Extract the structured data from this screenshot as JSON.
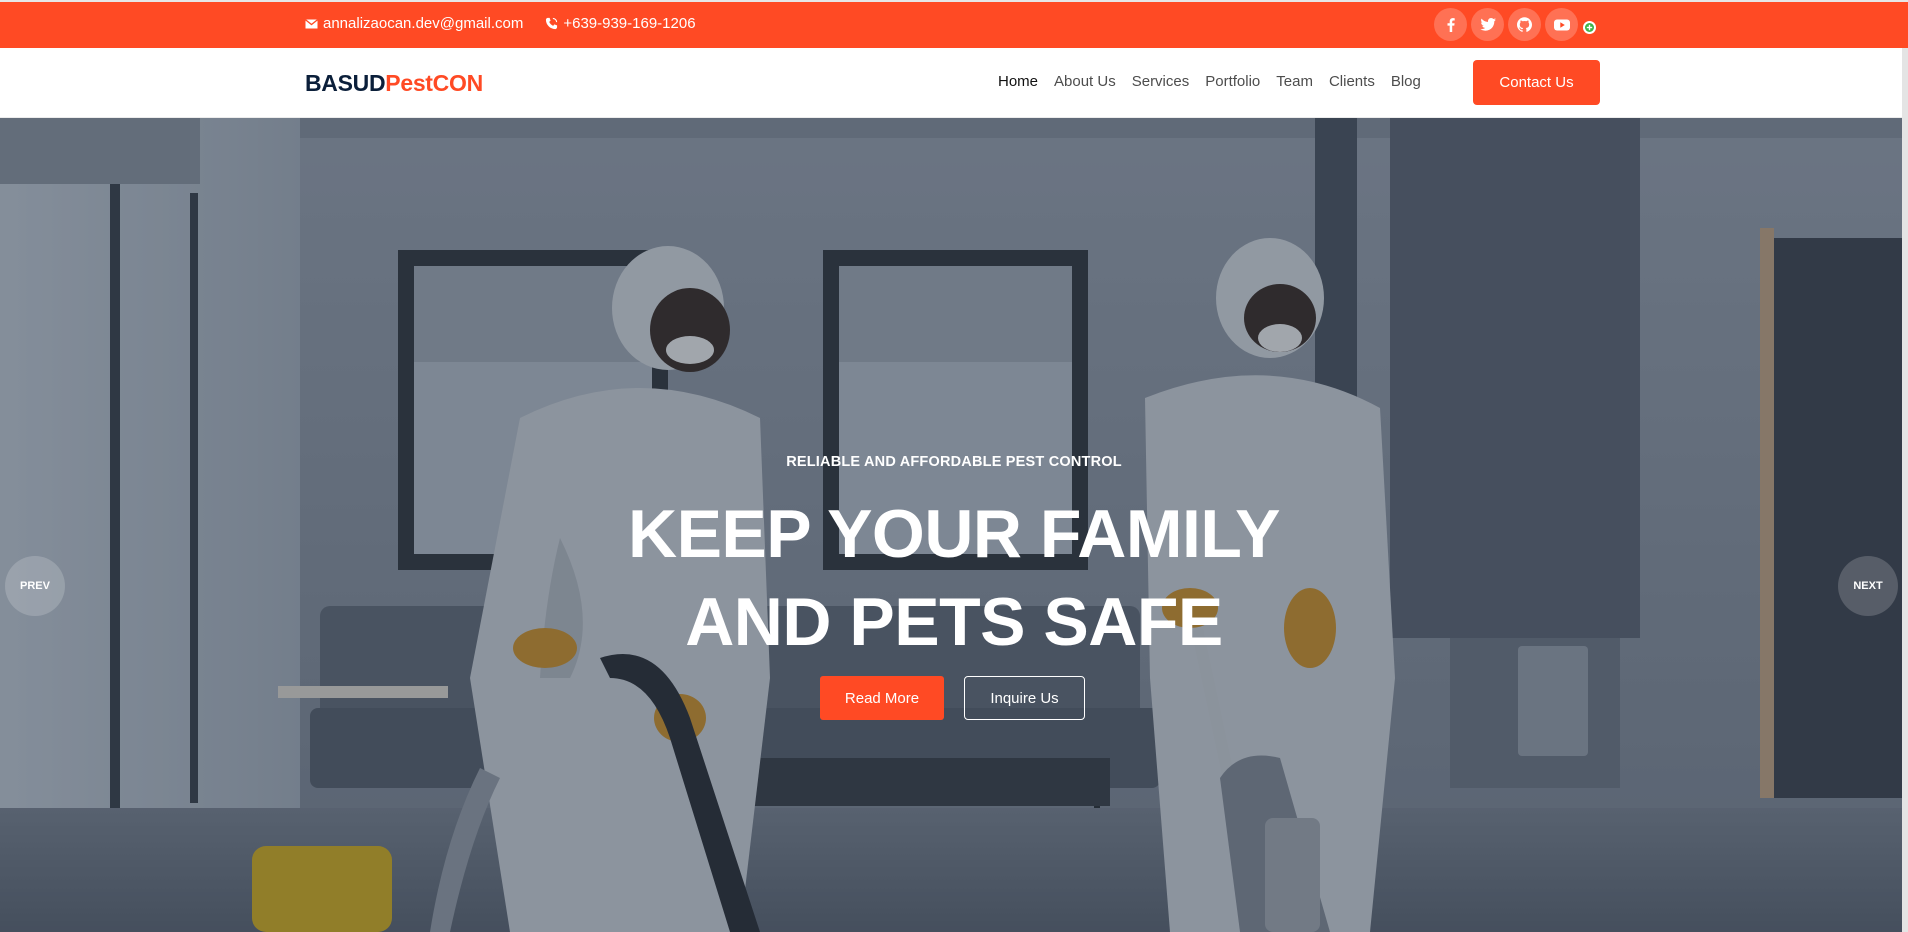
{
  "topbar": {
    "email": "annalizaocan.dev@gmail.com",
    "phone": "+639-939-169-1206",
    "social_icons": [
      "facebook-icon",
      "twitter-icon",
      "github-icon",
      "youtube-icon"
    ],
    "background_color": "#ff4a24"
  },
  "header": {
    "logo_part1": "BASUD",
    "logo_part2": "PestCON",
    "nav": [
      {
        "label": "Home",
        "active": true
      },
      {
        "label": "About Us"
      },
      {
        "label": "Services"
      },
      {
        "label": "Portfolio"
      },
      {
        "label": "Team"
      },
      {
        "label": "Clients"
      },
      {
        "label": "Blog"
      }
    ],
    "cta_label": "Contact Us"
  },
  "hero": {
    "eyebrow": "RELIABLE AND AFFORDABLE PEST CONTROL",
    "headline_line1": "KEEP YOUR FAMILY",
    "headline_line2": "AND PETS SAFE",
    "primary_button": "Read More",
    "secondary_button": "Inquire Us",
    "prev_label": "PREV",
    "next_label": "NEXT"
  },
  "colors": {
    "accent": "#ff4a24",
    "logo_dark": "#0b1f3a"
  }
}
